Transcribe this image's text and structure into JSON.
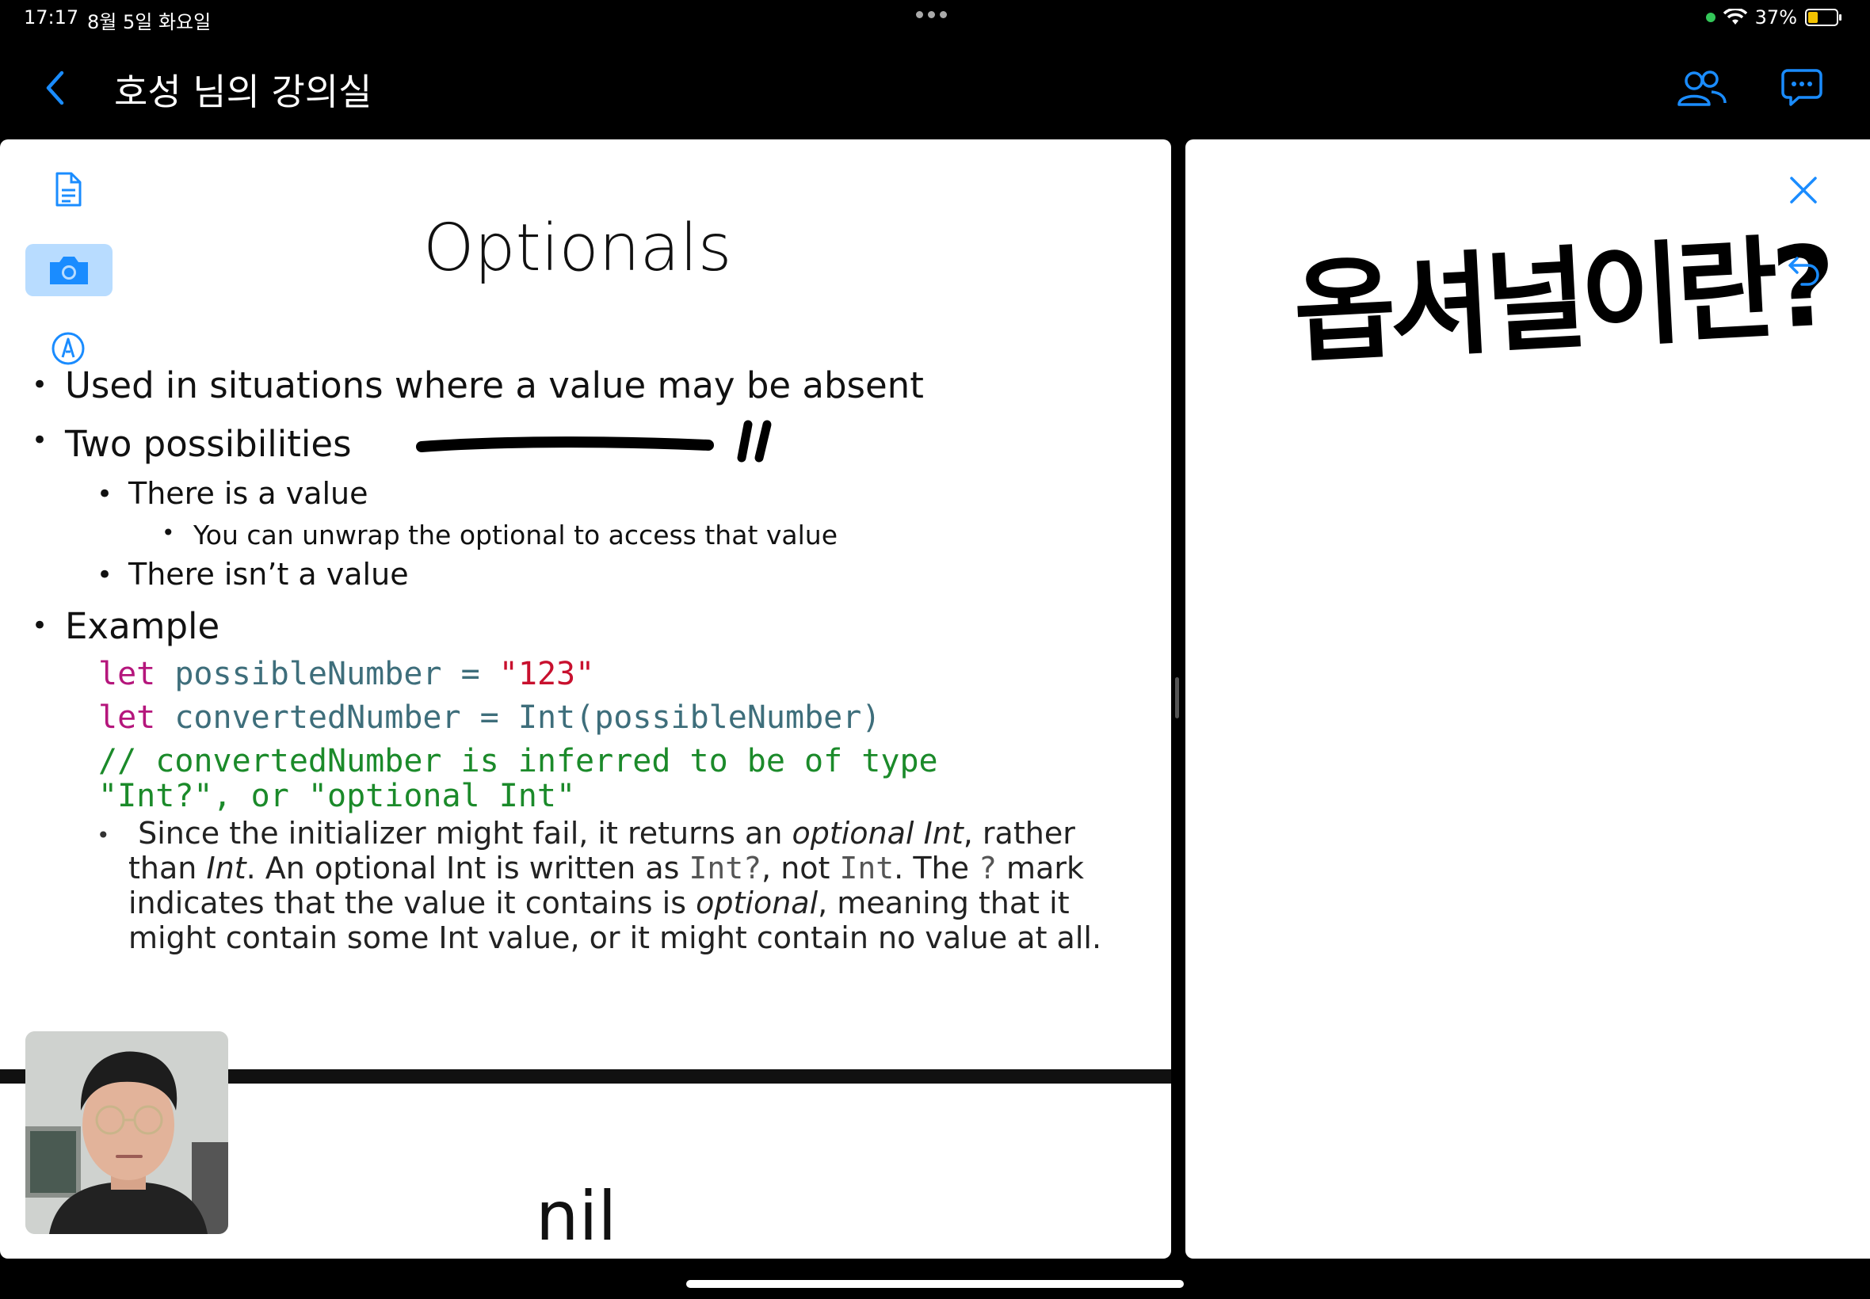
{
  "status_bar": {
    "time": "17:17",
    "date": "8월 5일 화요일",
    "battery": "37%"
  },
  "nav": {
    "title": "호성 님의 강의실"
  },
  "slide": {
    "title": "Optionals",
    "bullets": [
      "Used in situations where a value may be absent",
      "Two possibilities",
      "There is a value",
      "You can unwrap the optional to access that value",
      "There isn’t a value",
      "Example"
    ],
    "code": {
      "line1": {
        "kw": "let",
        "ident": "possibleNumber",
        "op": "=",
        "str": "\"123\""
      },
      "line2": {
        "kw": "let",
        "ident": "convertedNumber",
        "op": "=",
        "type": "Int",
        "arg": "(possibleNumber)"
      },
      "comment1": "// convertedNumber is inferred to be of type",
      "comment2": "\"Int?\", or \"optional Int\""
    },
    "paragraph": {
      "p1": "Since the initializer might fail, it returns an ",
      "p2": "optional Int",
      "p3": ", rather than ",
      "p4": "Int",
      "p5": ". An optional Int is written as ",
      "p6": "Int?",
      "p7": ", not ",
      "p8": "Int",
      "p9": ". The ",
      "p10": "?",
      "p11": " mark indicates that the value it contains is ",
      "p12": "optional",
      "p13": ", meaning that it might contain some Int value, or it might contain no value at all."
    },
    "next_slide_text": "nil"
  },
  "handwriting": {
    "right_panel": "옵셔널이란?"
  },
  "icons": {
    "back": "chevron-left-icon",
    "participants": "people-icon",
    "chat": "chat-bubble-icon",
    "document": "document-icon",
    "camera": "camera-icon",
    "pen": "pen-icon",
    "close": "close-icon",
    "undo": "undo-icon"
  },
  "colors": {
    "accent": "#1a8cff",
    "keyword": "#b5167c",
    "string": "#c8102e",
    "comment": "#1b8a2a"
  }
}
